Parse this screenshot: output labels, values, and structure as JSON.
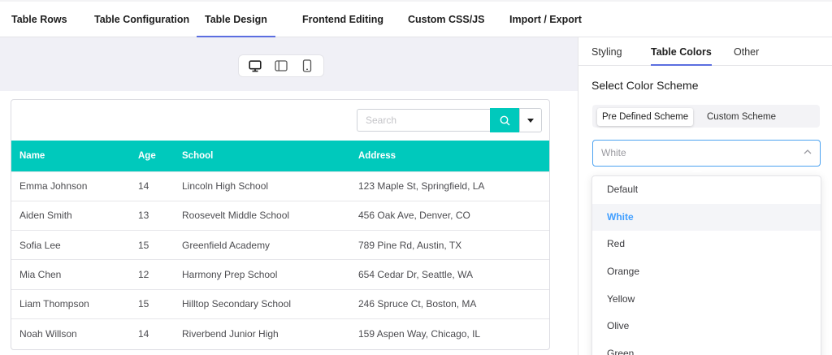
{
  "top_tabs": [
    {
      "label": "Table Rows"
    },
    {
      "label": "Table Configuration"
    },
    {
      "label": "Table Design"
    },
    {
      "label": "Frontend Editing"
    },
    {
      "label": "Custom CSS/JS"
    },
    {
      "label": "Import / Export"
    }
  ],
  "active_top_tab": "Table Design",
  "device_icons": [
    "desktop-icon",
    "tablet-icon",
    "mobile-icon"
  ],
  "search": {
    "placeholder": "Search"
  },
  "table": {
    "headers": [
      "Name",
      "Age",
      "School",
      "Address"
    ],
    "rows": [
      [
        "Emma Johnson",
        "14",
        "Lincoln High School",
        "123 Maple St, Springfield, LA"
      ],
      [
        "Aiden Smith",
        "13",
        "Roosevelt Middle School",
        "456 Oak Ave, Denver, CO"
      ],
      [
        "Sofia Lee",
        "15",
        "Greenfield Academy",
        "789 Pine Rd, Austin, TX"
      ],
      [
        "Mia Chen",
        "12",
        "Harmony Prep School",
        "654 Cedar Dr, Seattle, WA"
      ],
      [
        "Liam Thompson",
        "15",
        "Hilltop Secondary School",
        "246 Spruce Ct, Boston, MA"
      ],
      [
        "Noah Willson",
        "14",
        "Riverbend Junior High",
        "159 Aspen Way, Chicago, IL"
      ]
    ]
  },
  "sidebar": {
    "tabs": [
      {
        "label": "Styling"
      },
      {
        "label": "Table Colors"
      },
      {
        "label": "Other"
      }
    ],
    "active_tab": "Table Colors",
    "section_title": "Select Color Scheme",
    "scheme_options": [
      {
        "label": "Pre Defined Scheme"
      },
      {
        "label": "Custom Scheme"
      }
    ],
    "active_scheme": "Pre Defined Scheme",
    "select_value": "White",
    "dropdown_options": [
      "Default",
      "White",
      "Red",
      "Orange",
      "Yellow",
      "Olive",
      "Green"
    ],
    "selected_option": "White"
  },
  "colors": {
    "header_bg": "#00c9bc",
    "accent_underline": "#5b6ee0",
    "select_border": "#4da3f1",
    "selected_option_text": "#409eff"
  }
}
